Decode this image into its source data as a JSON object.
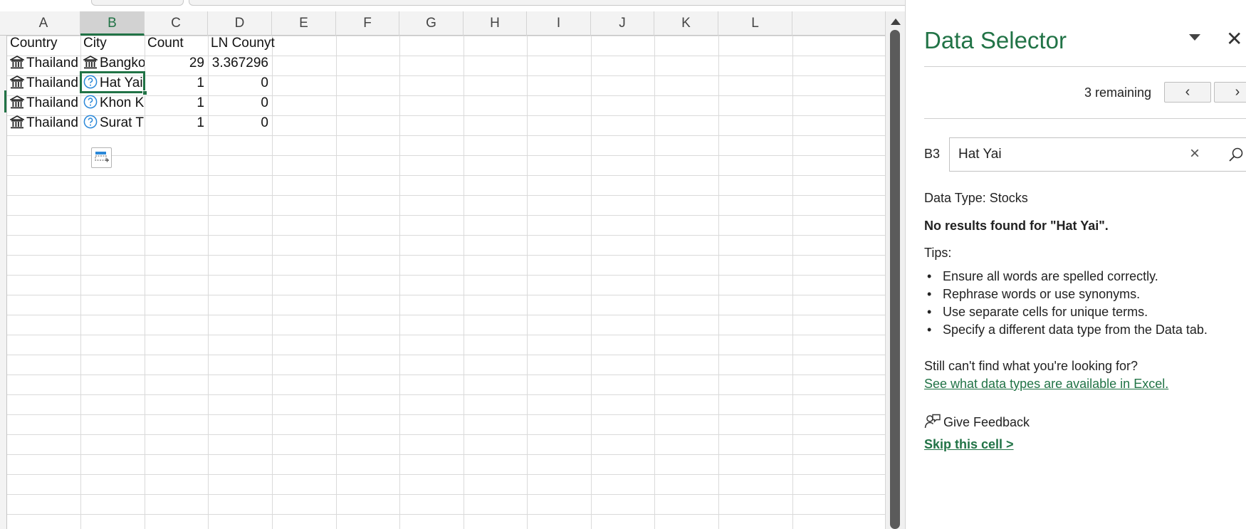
{
  "sheet": {
    "columns": [
      "A",
      "B",
      "C",
      "D",
      "E",
      "F",
      "G",
      "H",
      "I",
      "J",
      "K",
      "L"
    ],
    "selected_column": "B",
    "headers": [
      "Country",
      "City",
      "Count",
      "LN Counyt"
    ],
    "rows": [
      {
        "country": "Thailand",
        "city": "Bangko",
        "count": "29",
        "ln": "3.367296",
        "city_icon": "building-icon"
      },
      {
        "country": "Thailand",
        "city": "Hat Yai",
        "count": "1",
        "ln": "0",
        "city_icon": "question-icon"
      },
      {
        "country": "Thailand",
        "city": "Khon Ka",
        "count": "1",
        "ln": "0",
        "city_icon": "question-icon"
      },
      {
        "country": "Thailand",
        "city": "Surat Th",
        "count": "1",
        "ln": "0",
        "city_icon": "question-icon"
      }
    ],
    "country_icon": "building-icon",
    "active_cell": "B3"
  },
  "pane": {
    "title": "Data Selector",
    "remaining": "3 remaining",
    "prev_label": "‹",
    "next_label": "›",
    "cell_ref": "B3",
    "search_value": "Hat Yai",
    "data_type": "Data Type: Stocks",
    "no_results": "No results found for \"Hat Yai\".",
    "tips_heading": "Tips:",
    "tips": [
      "Ensure all words are spelled correctly.",
      "Rephrase words or use synonyms.",
      "Use separate cells for unique terms.",
      "Specify a different data type from the Data tab."
    ],
    "still_cant": "Still can't find what you're looking for?",
    "data_types_link": "See what data types are available in Excel.",
    "feedback": "Give Feedback",
    "skip": "Skip this cell >"
  },
  "colors": {
    "accent": "#217346",
    "question_icon": "#2b88d8"
  }
}
